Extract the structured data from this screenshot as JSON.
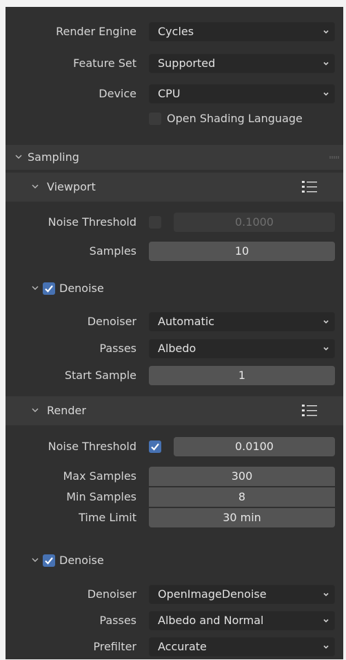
{
  "render_engine": {
    "label": "Render Engine",
    "value": "Cycles"
  },
  "feature_set": {
    "label": "Feature Set",
    "value": "Supported"
  },
  "device": {
    "label": "Device",
    "value": "CPU"
  },
  "osl": {
    "label": "Open Shading Language",
    "checked": false
  },
  "sampling": {
    "title": "Sampling",
    "viewport": {
      "title": "Viewport",
      "noise_threshold": {
        "label": "Noise Threshold",
        "checked": false,
        "value": "0.1000"
      },
      "samples": {
        "label": "Samples",
        "value": "10"
      },
      "denoise": {
        "label": "Denoise",
        "checked": true,
        "denoiser": {
          "label": "Denoiser",
          "value": "Automatic"
        },
        "passes": {
          "label": "Passes",
          "value": "Albedo"
        },
        "start_sample": {
          "label": "Start Sample",
          "value": "1"
        }
      }
    },
    "render": {
      "title": "Render",
      "noise_threshold": {
        "label": "Noise Threshold",
        "checked": true,
        "value": "0.0100"
      },
      "max_samples": {
        "label": "Max Samples",
        "value": "300"
      },
      "min_samples": {
        "label": "Min Samples",
        "value": "8"
      },
      "time_limit": {
        "label": "Time Limit",
        "value": "30 min"
      },
      "denoise": {
        "label": "Denoise",
        "checked": true,
        "denoiser": {
          "label": "Denoiser",
          "value": "OpenImageDenoise"
        },
        "passes": {
          "label": "Passes",
          "value": "Albedo and Normal"
        },
        "prefilter": {
          "label": "Prefilter",
          "value": "Accurate"
        }
      }
    }
  },
  "colors": {
    "panel": "#303030",
    "subpanel": "#3a3a3a",
    "field": "#545454",
    "dropdown": "#282828",
    "accent": "#4772b3"
  }
}
